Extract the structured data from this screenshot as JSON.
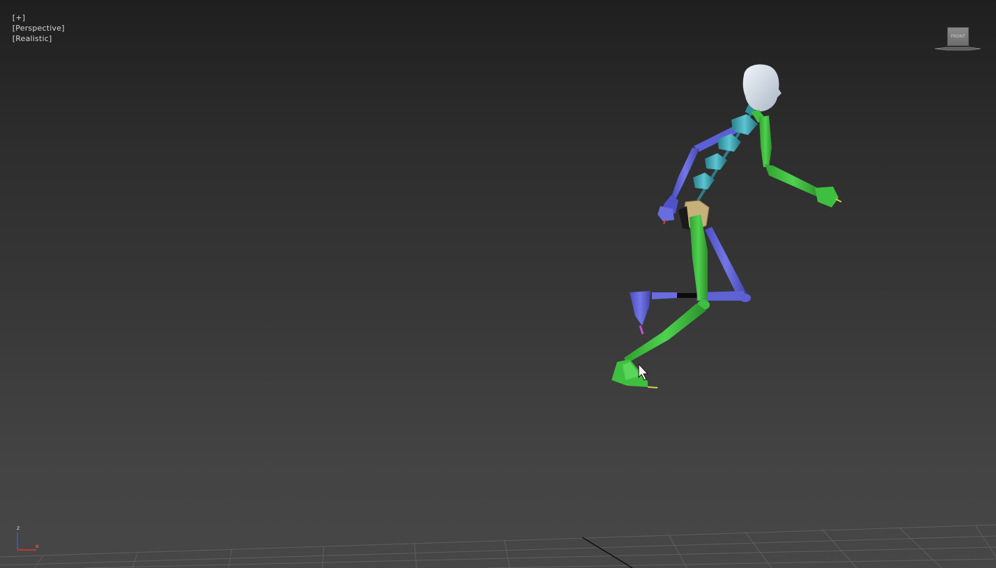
{
  "viewport": {
    "label_plus": "[+]",
    "label_view": "[Perspective]",
    "label_shading": "[Realistic]"
  },
  "viewcube": {
    "face_label": "FRONT",
    "icon": "viewcube-icon"
  },
  "axis_tripod": {
    "z_label": "z",
    "x_label": "x",
    "icon": "axis-tripod-icon"
  },
  "scene": {
    "object": "biped-skeleton",
    "grid": "home-grid",
    "cursor_icon": "mouse-pointer-icon"
  },
  "colors": {
    "background_top": "#1f1f1f",
    "background_bottom": "#474747",
    "biped_left": "#5c5fd6",
    "biped_right": "#3fbf3f",
    "biped_spine": "#3aa4b4",
    "biped_pelvis": "#c8b07a",
    "biped_head": "#dfe6ee",
    "grid_line": "#5e5e5e"
  }
}
